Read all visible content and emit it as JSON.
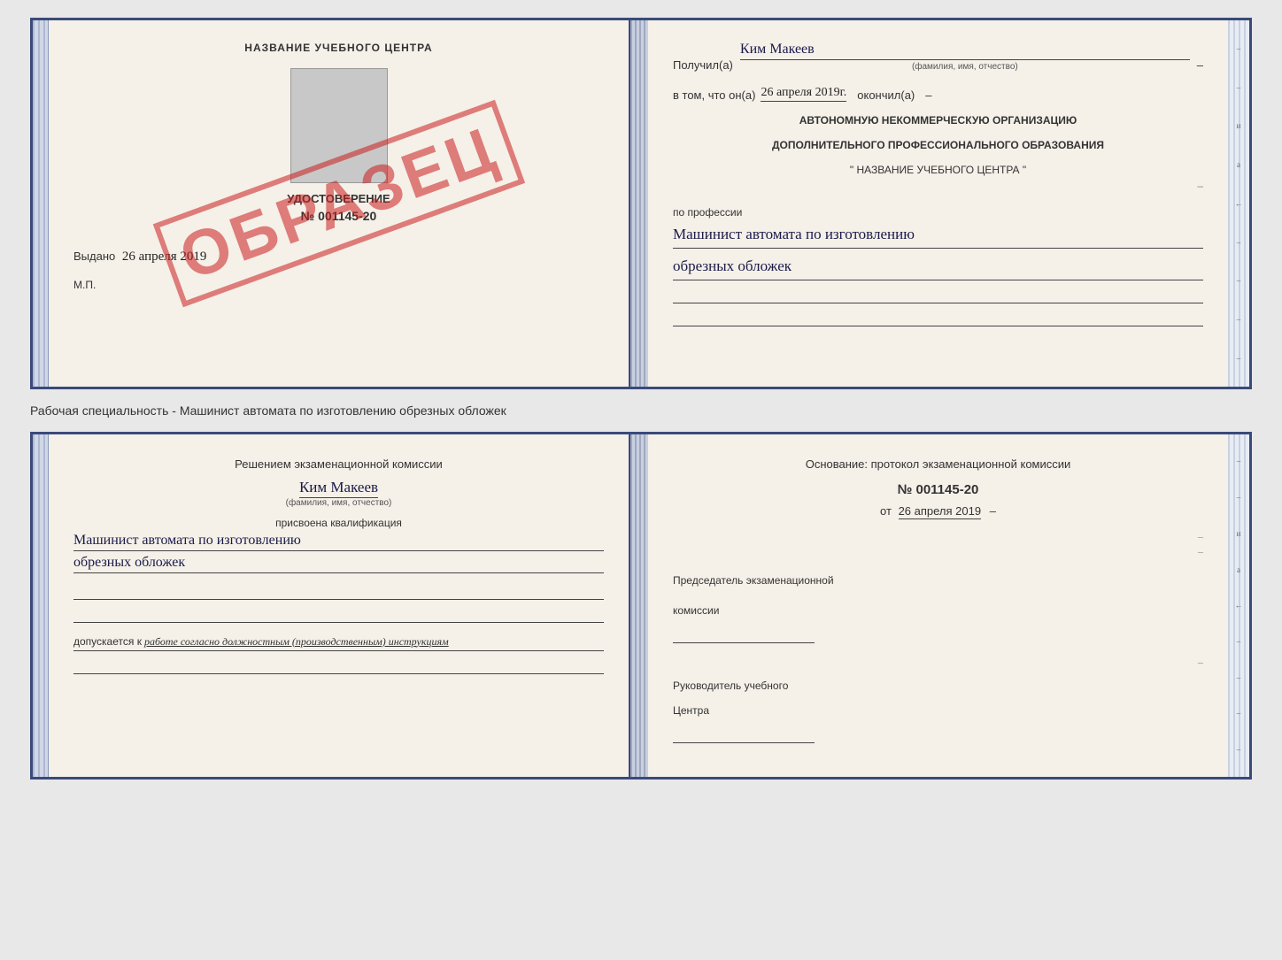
{
  "page": {
    "background": "#e8e8e8"
  },
  "doc_top": {
    "left": {
      "title": "НАЗВАНИЕ УЧЕБНОГО ЦЕНТРА",
      "stamp": "ОБРАЗЕЦ",
      "cert_subtitle": "УДОСТОВЕРЕНИЕ",
      "cert_number": "№ 001145-20",
      "issued_label": "Выдано",
      "issued_date": "26 апреля 2019",
      "mp_label": "М.П."
    },
    "right": {
      "received_label": "Получил(а)",
      "recipient_name": "Ким Макеев",
      "name_undertext": "(фамилия, имя, отчество)",
      "in_that_label": "в том, что он(а)",
      "completion_date": "26 апреля 2019г.",
      "completed_label": "окончил(а)",
      "org_line1": "АВТОНОМНУЮ НЕКОММЕРЧЕСКУЮ ОРГАНИЗАЦИЮ",
      "org_line2": "ДОПОЛНИТЕЛЬНОГО ПРОФЕССИОНАЛЬНОГО ОБРАЗОВАНИЯ",
      "org_line3": "\"  НАЗВАНИЕ УЧЕБНОГО ЦЕНТРА  \"",
      "profession_label": "по профессии",
      "profession_line1": "Машинист автомата по изготовлению",
      "profession_line2": "обрезных обложек"
    }
  },
  "between_label": "Рабочая специальность - Машинист автомата по изготовлению обрезных обложек",
  "doc_bottom": {
    "left": {
      "decision_line1": "Решением экзаменационной комиссии",
      "person_name": "Ким Макеев",
      "name_undertext": "(фамилия, имя, отчество)",
      "assigned_label": "присвоена квалификация",
      "qualification_line1": "Машинист автомата по изготовлению",
      "qualification_line2": "обрезных обложек",
      "allowed_text": "допускается к работе согласно должностным (производственным) инструкциям"
    },
    "right": {
      "basis_label": "Основание: протокол экзаменационной комиссии",
      "protocol_number": "№  001145-20",
      "protocol_date_prefix": "от",
      "protocol_date": "26 апреля 2019",
      "chairman_label": "Председатель экзаменационной",
      "chairman_label2": "комиссии",
      "director_label": "Руководитель учебного",
      "director_label2": "Центра"
    }
  },
  "right_edge_marks": [
    "–",
    "–",
    "и",
    "а",
    "←",
    "–",
    "–",
    "–",
    "–"
  ]
}
